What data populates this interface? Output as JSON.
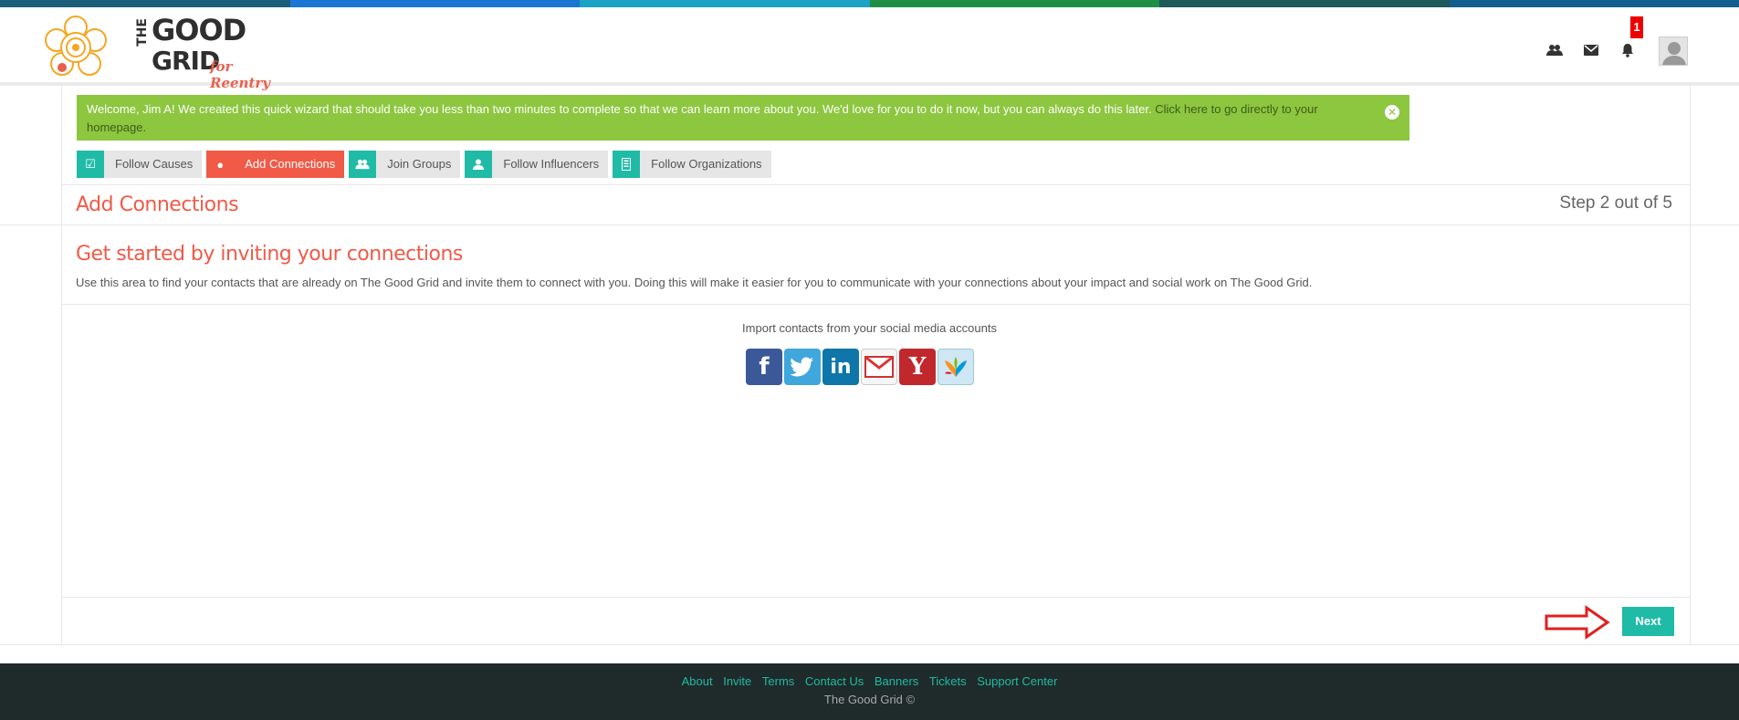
{
  "colors": {
    "strip": [
      "#1a4f7a",
      "#1976d2",
      "#1aa0c8",
      "#1f8f46",
      "#1f5a5a",
      "#115e8f"
    ],
    "accent_orange": "#f05a47",
    "teal": "#1fbba6",
    "alert_green": "#8dc63f",
    "footer_bg": "#1f2a2a"
  },
  "logo": {
    "the": "THE",
    "good": "GOOD",
    "grid": "GRID",
    "tagline": "for Reentry"
  },
  "header": {
    "icons": [
      "people-icon",
      "envelope-icon",
      "bell-icon"
    ],
    "notification_count": "1"
  },
  "alert": {
    "message": "Welcome, Jim A! We created this quick wizard that should take you less than two minutes to complete so that we can learn more about you. We'd love for you to do it now, but you can always do this later.",
    "link_text": "Click here to go directly to your homepage."
  },
  "steps": [
    {
      "label": "Follow Causes",
      "icon": "checkbox-icon",
      "active": false
    },
    {
      "label": "Add Connections",
      "icon": "globe-icon",
      "active": true
    },
    {
      "label": "Join Groups",
      "icon": "group-icon",
      "active": false
    },
    {
      "label": "Follow Influencers",
      "icon": "user-icon",
      "active": false
    },
    {
      "label": "Follow Organizations",
      "icon": "building-icon",
      "active": false
    }
  ],
  "section": {
    "title": "Add Connections",
    "step_count": "Step 2 out of 5"
  },
  "invite": {
    "title": "Get started by inviting your connections",
    "description": "Use this area to find your contacts that are already on The Good Grid and invite them to connect with you. Doing this will make it easier for you to communicate with your connections about your impact and social work on The Good Grid."
  },
  "import": {
    "label": "Import contacts from your social media accounts",
    "providers": [
      "facebook",
      "twitter",
      "linkedin",
      "gmail",
      "yahoo",
      "msn"
    ]
  },
  "next_label": "Next",
  "footer": {
    "links": [
      "About",
      "Invite",
      "Terms",
      "Contact Us",
      "Banners",
      "Tickets",
      "Support Center"
    ],
    "copyright": "The Good Grid ©"
  }
}
